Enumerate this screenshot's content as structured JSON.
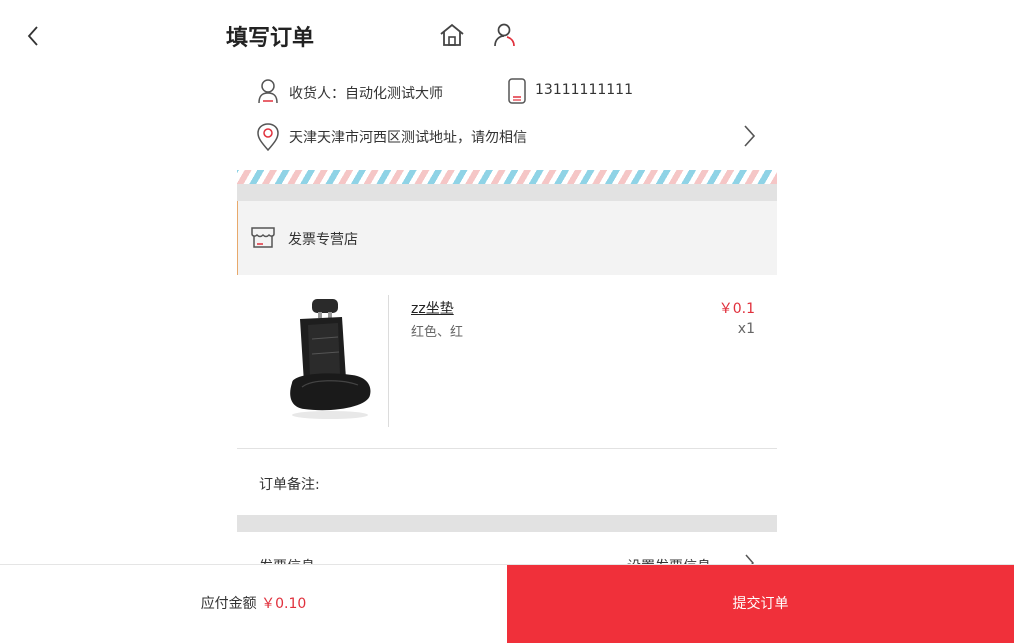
{
  "header": {
    "title": "填写订单"
  },
  "address": {
    "receiver": "收货人：自动化测试大师",
    "phone": "13111111111",
    "detail": "天津天津市河西区测试地址，请勿相信"
  },
  "store": {
    "name": "发票专营店"
  },
  "product": {
    "name": "zz坐垫",
    "spec": "红色、红",
    "price": "￥0.1",
    "qty": "x1"
  },
  "remark": {
    "label": "订单备注:",
    "value": ""
  },
  "invoice": {
    "label": "发票信息",
    "value": "设置发票信息"
  },
  "footer": {
    "pay_label": "应付金额",
    "pay_amount": "￥0.10",
    "submit_label": "提交订单"
  },
  "colors": {
    "accent": "#f0303a",
    "price": "#e0303c"
  }
}
